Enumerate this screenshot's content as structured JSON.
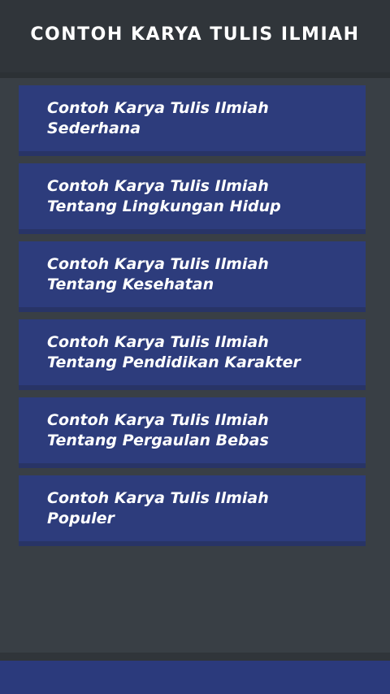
{
  "header": {
    "title": "Contoh Karya Tulis Ilmiah"
  },
  "menu": {
    "items": [
      {
        "label": "Contoh Karya Tulis Ilmiah\nSederhana"
      },
      {
        "label": "Contoh Karya Tulis Ilmiah\nTentang Lingkungan Hidup"
      },
      {
        "label": "Contoh Karya Tulis Ilmiah\nTentang Kesehatan"
      },
      {
        "label": "Contoh Karya Tulis Ilmiah\nTentang Pendidikan Karakter"
      },
      {
        "label": "Contoh Karya Tulis Ilmiah\nTentang Pergaulan Bebas"
      },
      {
        "label": "Contoh Karya Tulis Ilmiah\nPopuler"
      }
    ]
  },
  "colors": {
    "background": "#393f45",
    "header": "#30353a",
    "button": "#2d3c7c",
    "button_shadow": "#283466",
    "footer": "#2b3a7c"
  }
}
